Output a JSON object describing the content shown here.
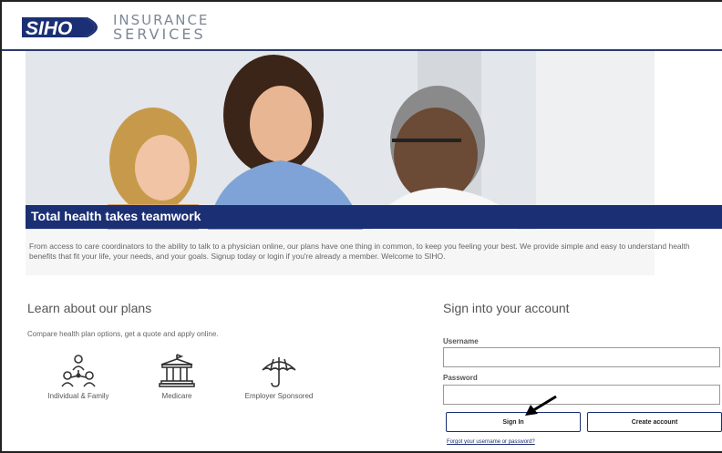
{
  "brand": {
    "logo_mark": "SIHO",
    "logo_line1": "INSURANCE",
    "logo_line2": "SERVICES",
    "primary_color": "#1b2f74"
  },
  "hero": {
    "headline": "Total health takes teamwork",
    "intro": "From access to care coordinators to the ability to talk to a physician online, our plans have one thing in common, to keep you feeling your best. We provide simple and easy to understand health benefits that fit your life, your needs, and your goals. Signup today or login if you're already a member. Welcome to SIHO."
  },
  "plans": {
    "title": "Learn about our plans",
    "subtitle": "Compare health plan options, get a quote and apply online.",
    "items": [
      {
        "label": "Individual & Family",
        "icon": "family-icon"
      },
      {
        "label": "Medicare",
        "icon": "building-icon"
      },
      {
        "label": "Employer Sponsored",
        "icon": "umbrella-icon"
      }
    ]
  },
  "signin": {
    "title": "Sign into your account",
    "username_label": "Username",
    "username_value": "",
    "password_label": "Password",
    "password_value": "",
    "signin_label": "Sign In",
    "create_label": "Create account",
    "forgot_label": "Forgot your username or password?"
  }
}
